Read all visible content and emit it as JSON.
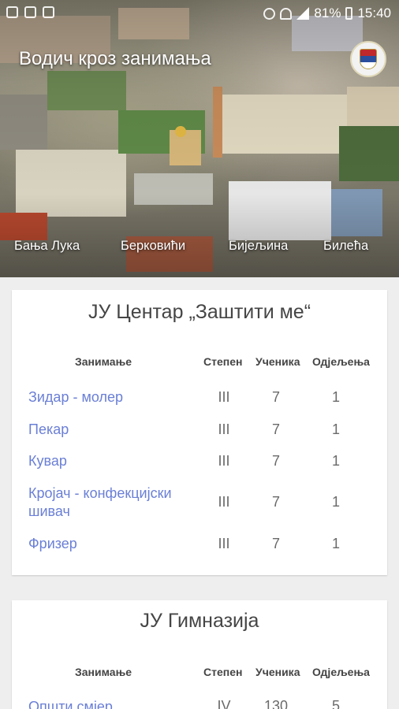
{
  "status": {
    "battery": "81%",
    "time": "15:40"
  },
  "app": {
    "title": "Водич кроз занимања"
  },
  "tabs": [
    {
      "label": "Бања Лука"
    },
    {
      "label": "Берковићи"
    },
    {
      "label": "Бијељина"
    },
    {
      "label": "Билећа"
    }
  ],
  "columns": {
    "occupation": "Занимање",
    "degree": "Степен",
    "students": "Ученика",
    "classes": "Одјељења"
  },
  "schools": [
    {
      "name": "ЈУ Центар „Заштити ме“",
      "rows": [
        {
          "occupation": "Зидар - молер",
          "degree": "III",
          "students": "7",
          "classes": "1"
        },
        {
          "occupation": "Пекар",
          "degree": "III",
          "students": "7",
          "classes": "1"
        },
        {
          "occupation": "Кувар",
          "degree": "III",
          "students": "7",
          "classes": "1"
        },
        {
          "occupation": "Кројач - конфекцијски шивач",
          "degree": "III",
          "students": "7",
          "classes": "1"
        },
        {
          "occupation": "Фризер",
          "degree": "III",
          "students": "7",
          "classes": "1"
        }
      ]
    },
    {
      "name": "ЈУ Гимназија",
      "rows": [
        {
          "occupation": "Општи смјер",
          "degree": "IV",
          "students": "130",
          "classes": "5"
        }
      ]
    }
  ],
  "colors": {
    "link": "#6a7fd6",
    "text": "#454545",
    "background": "#eeeeee"
  }
}
